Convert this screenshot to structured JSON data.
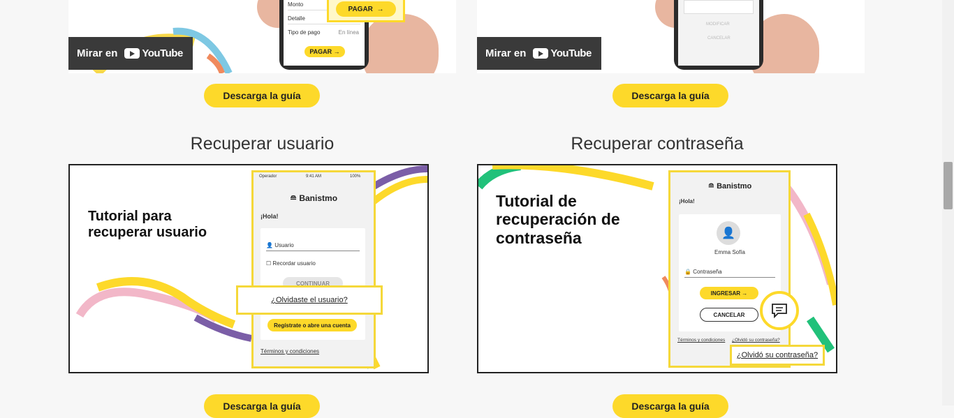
{
  "videos": [
    {
      "watch_label": "Mirar en",
      "platform": "YouTube",
      "screen": {
        "rows": [
          "Monto",
          "Detalle",
          "Tipo de pago"
        ],
        "row_value": "En línea",
        "pay_label": "PAGAR"
      }
    },
    {
      "watch_label": "Mirar en",
      "platform": "YouTube",
      "screen": {
        "btn1": "MODIFICAR",
        "btn2": "CANCELAR"
      }
    }
  ],
  "download_label": "Descarga la guía",
  "sections": [
    {
      "title": "Recuperar usuario",
      "card_title": "Tutorial para recuperar usuario",
      "mock": {
        "operator": "Operador",
        "time": "9:41 AM",
        "battery": "100%",
        "brand": "Banistmo",
        "greeting": "¡Hola!",
        "user_placeholder": "Usuario",
        "remember": "Recordar usuario",
        "continue": "CONTINUAR",
        "forgot": "¿Olvidaste el usuario?",
        "register": "Regístrate o abre una cuenta",
        "terms": "Términos y condiciones"
      }
    },
    {
      "title": "Recuperar contraseña",
      "card_title": "Tutorial de recuperación de contraseña",
      "mock": {
        "brand": "Banistmo",
        "greeting": "¡Hola!",
        "user_name": "Emma Sofía",
        "password_placeholder": "Contraseña",
        "login": "INGRESAR",
        "cancel": "CANCELAR",
        "terms": "Términos y condiciones",
        "forgot_small": "¿Olvidó su contraseña?",
        "forgot": "¿Olvidó su contraseña?"
      }
    }
  ],
  "colors": {
    "accent": "#fdd92a",
    "background": "#f7f7f7",
    "badge": "#3a3a3a"
  }
}
